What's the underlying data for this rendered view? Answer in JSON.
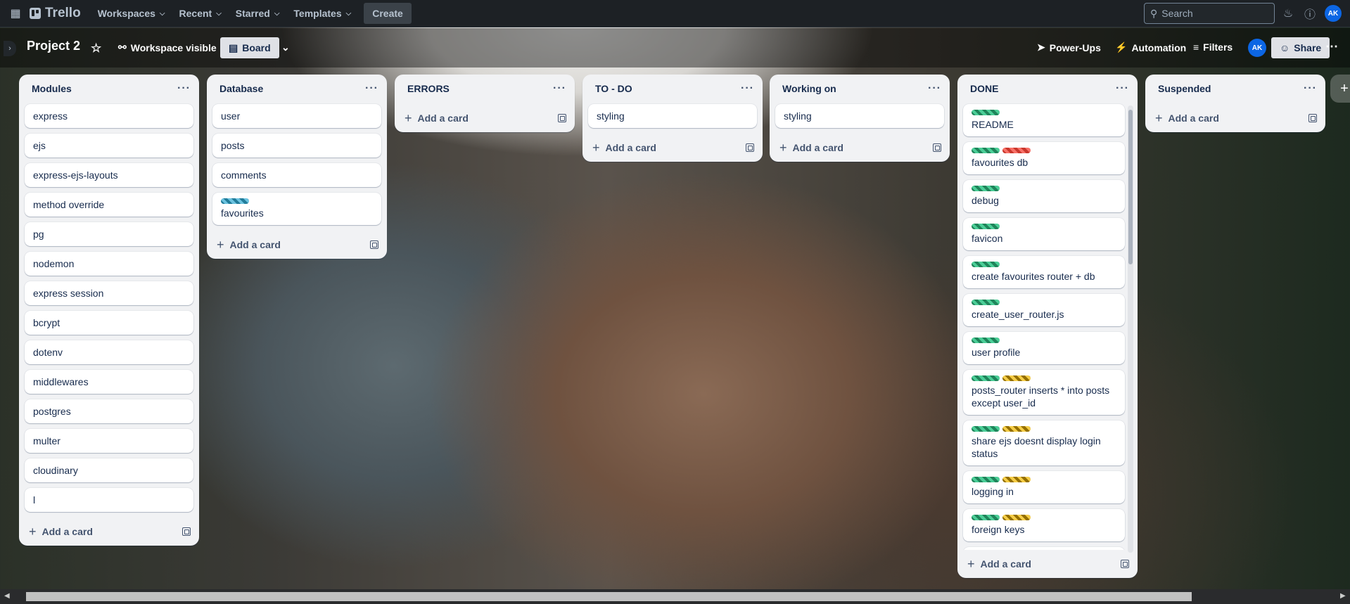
{
  "topbar": {
    "apps_icon": "grid-icon",
    "logo": "Trello",
    "nav": [
      "Workspaces",
      "Recent",
      "Starred",
      "Templates"
    ],
    "create": "Create",
    "search_placeholder": "Search",
    "avatar": "AK"
  },
  "board": {
    "title": "Project 2",
    "visibility": "Workspace visible",
    "view": "Board",
    "power_ups": "Power-Ups",
    "automation": "Automation",
    "filters": "Filters",
    "member": "AK",
    "share": "Share"
  },
  "add_card_label": "Add a card",
  "lists": [
    {
      "title": "Modules",
      "cards": [
        {
          "text": "express",
          "labels": []
        },
        {
          "text": "ejs",
          "labels": []
        },
        {
          "text": "express-ejs-layouts",
          "labels": []
        },
        {
          "text": "method override",
          "labels": []
        },
        {
          "text": "pg",
          "labels": []
        },
        {
          "text": "nodemon",
          "labels": []
        },
        {
          "text": "express session",
          "labels": []
        },
        {
          "text": "bcrypt",
          "labels": []
        },
        {
          "text": "dotenv",
          "labels": []
        },
        {
          "text": "middlewares",
          "labels": []
        },
        {
          "text": "postgres",
          "labels": []
        },
        {
          "text": "multer",
          "labels": []
        },
        {
          "text": "cloudinary",
          "labels": []
        },
        {
          "text": "l",
          "labels": []
        }
      ]
    },
    {
      "title": "Database",
      "cards": [
        {
          "text": "user",
          "labels": []
        },
        {
          "text": "posts",
          "labels": []
        },
        {
          "text": "comments",
          "labels": []
        },
        {
          "text": "favourites",
          "labels": [
            "blue"
          ]
        }
      ]
    },
    {
      "title": "ERRORS",
      "cards": []
    },
    {
      "title": "TO - DO",
      "cards": [
        {
          "text": "styling",
          "labels": []
        }
      ]
    },
    {
      "title": "Working on",
      "cards": [
        {
          "text": "styling",
          "labels": []
        }
      ]
    },
    {
      "title": "DONE",
      "cards": [
        {
          "text": "README",
          "labels": [
            "green"
          ]
        },
        {
          "text": "favourites db",
          "labels": [
            "green",
            "red"
          ]
        },
        {
          "text": "debug",
          "labels": [
            "green"
          ]
        },
        {
          "text": "favicon",
          "labels": [
            "green"
          ]
        },
        {
          "text": "create favourites router + db",
          "labels": [
            "green"
          ]
        },
        {
          "text": "create_user_router.js",
          "labels": [
            "green"
          ]
        },
        {
          "text": "user profile",
          "labels": [
            "green"
          ]
        },
        {
          "text": "posts_router inserts * into posts except user_id",
          "labels": [
            "green",
            "yellow"
          ]
        },
        {
          "text": "share ejs doesnt display login status",
          "labels": [
            "green",
            "yellow"
          ]
        },
        {
          "text": "logging in",
          "labels": [
            "green",
            "yellow"
          ]
        },
        {
          "text": "foreign keys",
          "labels": [
            "green",
            "yellow"
          ]
        },
        {
          "text": "",
          "labels": [
            "green",
            "yellow"
          ]
        }
      ]
    },
    {
      "title": "Suspended",
      "cards": []
    }
  ],
  "colors": {
    "green": "#4bce97",
    "red": "#f87168",
    "yellow": "#f5cd47",
    "blue": "#6cc3e0",
    "list_bg": "#f1f2f4",
    "topbar_bg": "#1d2125"
  }
}
